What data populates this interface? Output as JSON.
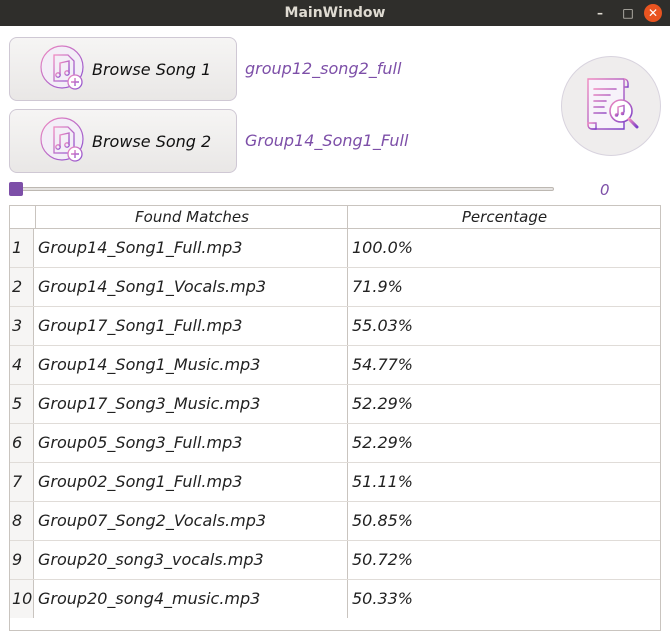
{
  "window": {
    "title": "MainWindow",
    "controls": {
      "minimize": "–",
      "maximize": "□",
      "close": "✕"
    }
  },
  "browse": [
    {
      "label": "Browse Song 1",
      "selected_song": "group12_song2_full",
      "icon": "music-file-add-icon"
    },
    {
      "label": "Browse Song 2",
      "selected_song": "Group14_Song1_Full",
      "icon": "music-file-add-icon"
    }
  ],
  "search": {
    "icon": "music-document-search-icon"
  },
  "slider": {
    "value": "0",
    "fraction": 0
  },
  "table": {
    "headers": [
      "Found Matches",
      "Percentage"
    ],
    "rows": [
      {
        "index": "1",
        "name": "Group14_Song1_Full.mp3",
        "percentage": "100.0%"
      },
      {
        "index": "2",
        "name": "Group14_Song1_Vocals.mp3",
        "percentage": "71.9%"
      },
      {
        "index": "3",
        "name": "Group17_Song1_Full.mp3",
        "percentage": "55.03%"
      },
      {
        "index": "4",
        "name": "Group14_Song1_Music.mp3",
        "percentage": "54.77%"
      },
      {
        "index": "5",
        "name": "Group17_Song3_Music.mp3",
        "percentage": "52.29%"
      },
      {
        "index": "6",
        "name": "Group05_Song3_Full.mp3",
        "percentage": "52.29%"
      },
      {
        "index": "7",
        "name": "Group02_Song1_Full.mp3",
        "percentage": "51.11%"
      },
      {
        "index": "8",
        "name": "Group07_Song2_Vocals.mp3",
        "percentage": "50.85%"
      },
      {
        "index": "9",
        "name": "Group20_song3_vocals.mp3",
        "percentage": "50.72%"
      },
      {
        "index": "10",
        "name": "Group20_song4_music.mp3",
        "percentage": "50.33%"
      }
    ]
  },
  "colors": {
    "accent": "#7d4fa8",
    "titlebar": "#2f2e2b",
    "close": "#e95420"
  }
}
